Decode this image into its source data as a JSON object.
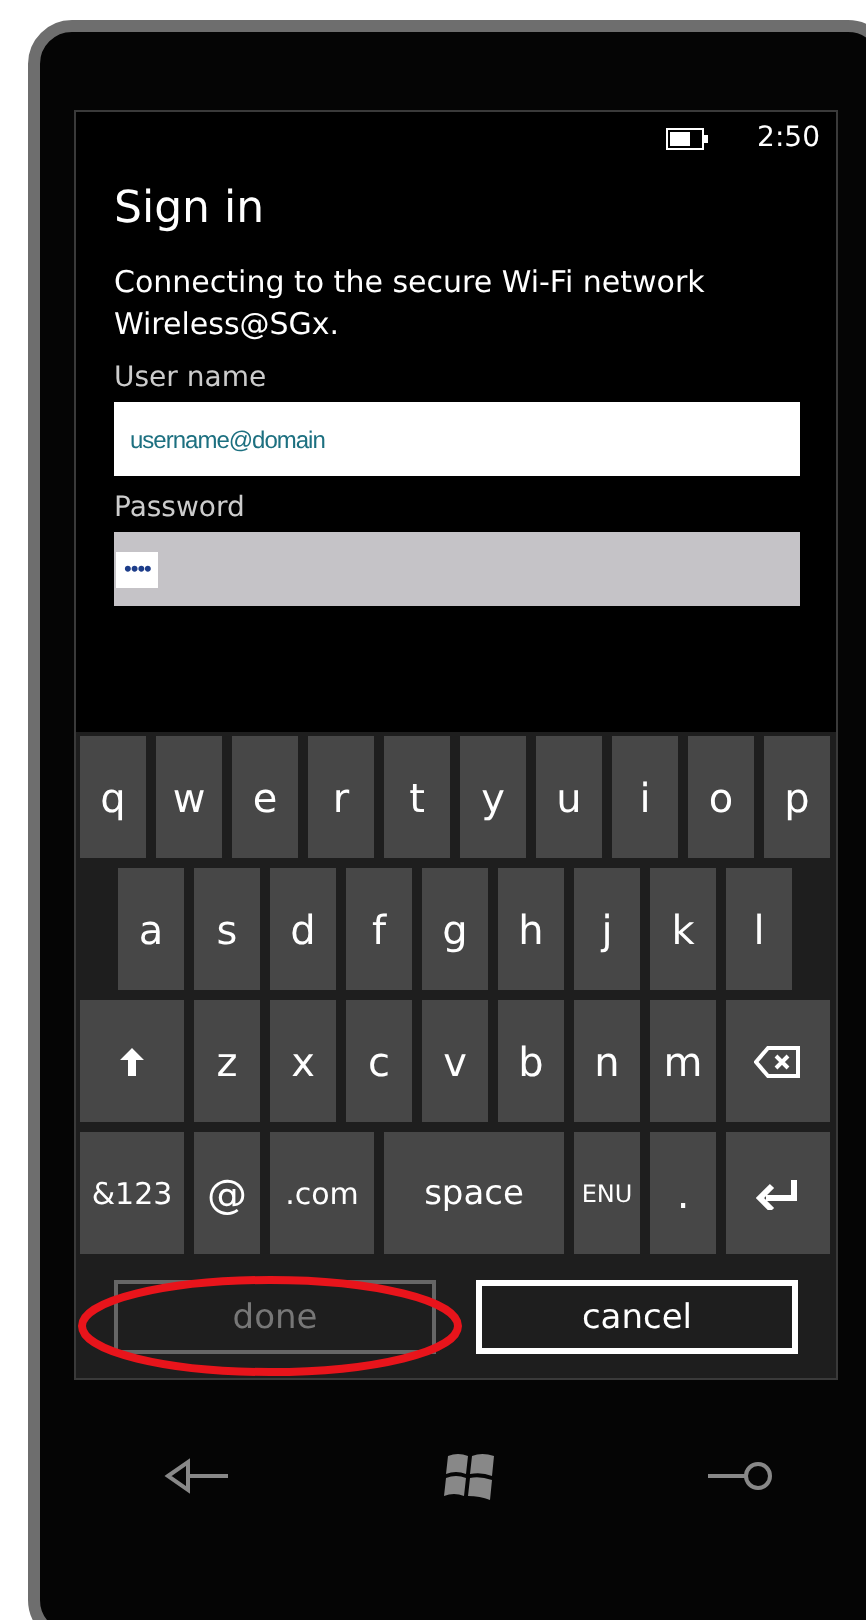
{
  "status_bar": {
    "time": "2:50"
  },
  "title": "Sign in",
  "message": "Connecting to the secure Wi-Fi network Wireless@SGx.",
  "fields": [
    {
      "label": "User name",
      "value": "username@domain",
      "focused": false
    },
    {
      "label": "Password",
      "value": "••••",
      "focused": true
    }
  ],
  "keyboard": {
    "rows": [
      {
        "keys": [
          {
            "kind": "char",
            "label": "q"
          },
          {
            "kind": "char",
            "label": "w"
          },
          {
            "kind": "char",
            "label": "e"
          },
          {
            "kind": "char",
            "label": "r"
          },
          {
            "kind": "char",
            "label": "t"
          },
          {
            "kind": "char",
            "label": "y"
          },
          {
            "kind": "char",
            "label": "u"
          },
          {
            "kind": "char",
            "label": "i"
          },
          {
            "kind": "char",
            "label": "o"
          },
          {
            "kind": "char",
            "label": "p"
          }
        ]
      },
      {
        "keys": [
          {
            "kind": "char",
            "label": "a"
          },
          {
            "kind": "char",
            "label": "s"
          },
          {
            "kind": "char",
            "label": "d"
          },
          {
            "kind": "char",
            "label": "f"
          },
          {
            "kind": "char",
            "label": "g"
          },
          {
            "kind": "char",
            "label": "h"
          },
          {
            "kind": "char",
            "label": "j"
          },
          {
            "kind": "char",
            "label": "k"
          },
          {
            "kind": "char",
            "label": "l"
          }
        ]
      },
      {
        "keys": [
          {
            "kind": "shift"
          },
          {
            "kind": "char",
            "label": "z"
          },
          {
            "kind": "char",
            "label": "x"
          },
          {
            "kind": "char",
            "label": "c"
          },
          {
            "kind": "char",
            "label": "v"
          },
          {
            "kind": "char",
            "label": "b"
          },
          {
            "kind": "char",
            "label": "n"
          },
          {
            "kind": "char",
            "label": "m"
          },
          {
            "kind": "backspace"
          }
        ]
      },
      {
        "keys": [
          {
            "kind": "wide",
            "label": "&123"
          },
          {
            "kind": "char",
            "label": "@"
          },
          {
            "kind": "wide",
            "label": ".com"
          },
          {
            "kind": "space",
            "label": "space"
          },
          {
            "kind": "lang",
            "label": "ENU"
          },
          {
            "kind": "char",
            "label": "."
          },
          {
            "kind": "enter"
          }
        ]
      }
    ]
  },
  "buttons": [
    {
      "label": "done",
      "disabled": true
    },
    {
      "label": "cancel",
      "disabled": false
    }
  ]
}
